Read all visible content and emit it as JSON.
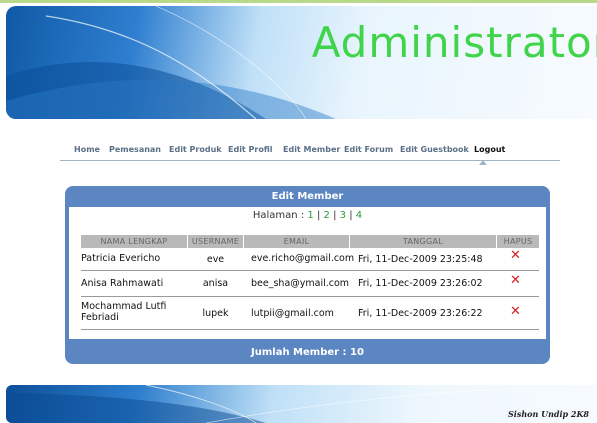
{
  "header": {
    "title": "Administrator"
  },
  "nav": {
    "items": [
      {
        "label": "Home"
      },
      {
        "label": "Pemesanan"
      },
      {
        "label": "Edit Produk"
      },
      {
        "label": "Edit Profil"
      },
      {
        "label": "Edit Member"
      },
      {
        "label": "Edit Forum"
      },
      {
        "label": "Edit Guestbook"
      },
      {
        "label": "Logout",
        "active": true
      }
    ]
  },
  "panel": {
    "title": "Edit Member",
    "pager_label": "Halaman :",
    "pages": [
      "1",
      "2",
      "3",
      "4"
    ],
    "columns": [
      "NAMA LENGKAP",
      "USERNAME",
      "EMAIL",
      "TANGGAL",
      "HAPUS"
    ],
    "rows": [
      {
        "name": "Patricia Evericho",
        "username": "eve",
        "email": "eve.richo@gmail.com",
        "date": "Fri, 11-Dec-2009 23:25:48",
        "delete_icon": "close-icon"
      },
      {
        "name": "Anisa Rahmawati",
        "username": "anisa",
        "email": "bee_sha@ymail.com",
        "date": "Fri, 11-Dec-2009 23:26:02",
        "delete_icon": "close-icon"
      },
      {
        "name": "Mochammad Lutfi Febriadi",
        "username": "lupek",
        "email": "lutpii@gmail.com",
        "date": "Fri, 11-Dec-2009 23:26:22",
        "delete_icon": "close-icon"
      }
    ],
    "footer": "Jumlah Member : 10"
  },
  "footer": {
    "credit": "Sishon Undip 2K8"
  },
  "colors": {
    "accent_green": "#3fd449",
    "panel_blue": "#5b86c2",
    "delete_red": "#d32222",
    "link_green": "#2a9a3a"
  }
}
